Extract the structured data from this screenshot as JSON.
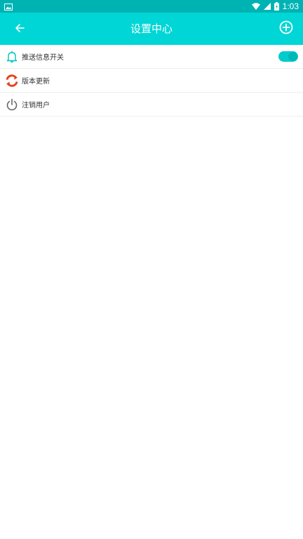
{
  "status_bar": {
    "time": "1:03",
    "icons": [
      "image-icon",
      "wifi-icon",
      "signal-icon",
      "battery-icon"
    ],
    "color": "#00b3b3"
  },
  "app_bar": {
    "title": "设置中心",
    "back_icon": "arrow-left-icon",
    "action_icon": "plus-circle-icon",
    "color": "#00d6d6"
  },
  "settings": {
    "items": [
      {
        "label": "推送信息开关",
        "icon": "bell-icon",
        "icon_color": "#00c2c2",
        "toggle_on": true
      },
      {
        "label": "版本更新",
        "icon": "refresh-icon",
        "icon_color": "#e8401c"
      },
      {
        "label": "注销用户",
        "icon": "power-icon",
        "icon_color": "#666666"
      }
    ]
  }
}
